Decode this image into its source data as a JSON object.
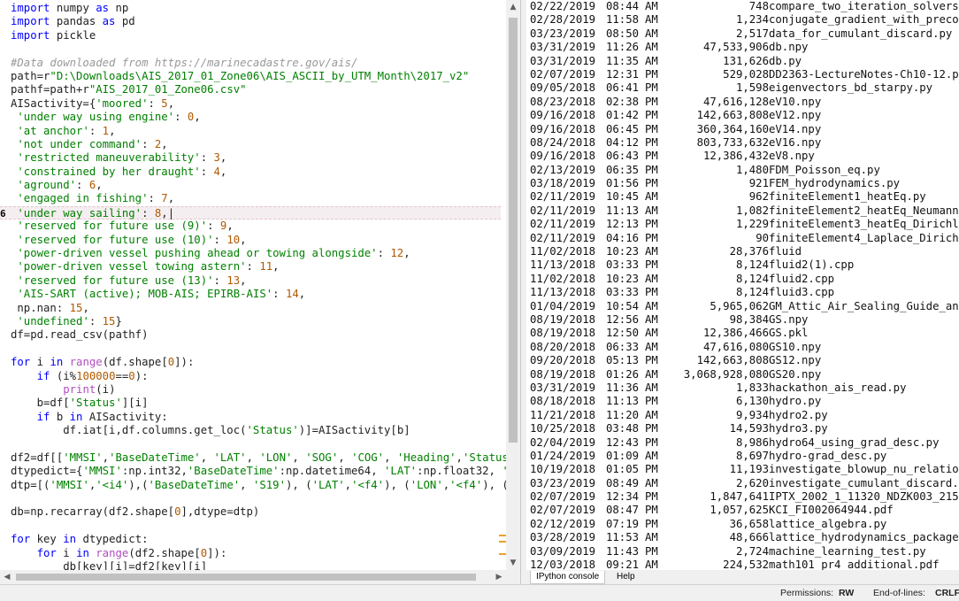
{
  "editor": {
    "lines": [
      [
        [
          "kw",
          "import"
        ],
        [
          "t",
          " numpy "
        ],
        [
          "kw",
          "as"
        ],
        [
          "t",
          " np"
        ]
      ],
      [
        [
          "kw",
          "import"
        ],
        [
          "t",
          " pandas "
        ],
        [
          "kw",
          "as"
        ],
        [
          "t",
          " pd"
        ]
      ],
      [
        [
          "kw",
          "import"
        ],
        [
          "t",
          " pickle"
        ]
      ],
      [],
      [
        [
          "com",
          "#Data downloaded from https://marinecadastre.gov/ais/"
        ]
      ],
      [
        [
          "t",
          "path=r"
        ],
        [
          "str",
          "\"D:\\Downloads\\AIS_2017_01_Zone06\\AIS_ASCII_by_UTM_Month\\2017_v2\""
        ]
      ],
      [
        [
          "t",
          "pathf=path+r"
        ],
        [
          "str",
          "\"AIS_2017_01_Zone06.csv\""
        ]
      ],
      [
        [
          "t",
          "AISactivity={"
        ],
        [
          "str",
          "'moored'"
        ],
        [
          "t",
          ": "
        ],
        [
          "num",
          "5"
        ],
        [
          "t",
          ","
        ]
      ],
      [
        [
          "t",
          " "
        ],
        [
          "str",
          "'under way using engine'"
        ],
        [
          "t",
          ": "
        ],
        [
          "num",
          "0"
        ],
        [
          "t",
          ","
        ]
      ],
      [
        [
          "t",
          " "
        ],
        [
          "str",
          "'at anchor'"
        ],
        [
          "t",
          ": "
        ],
        [
          "num",
          "1"
        ],
        [
          "t",
          ","
        ]
      ],
      [
        [
          "t",
          " "
        ],
        [
          "str",
          "'not under command'"
        ],
        [
          "t",
          ": "
        ],
        [
          "num",
          "2"
        ],
        [
          "t",
          ","
        ]
      ],
      [
        [
          "t",
          " "
        ],
        [
          "str",
          "'restricted maneuverability'"
        ],
        [
          "t",
          ": "
        ],
        [
          "num",
          "3"
        ],
        [
          "t",
          ","
        ]
      ],
      [
        [
          "t",
          " "
        ],
        [
          "str",
          "'constrained by her draught'"
        ],
        [
          "t",
          ": "
        ],
        [
          "num",
          "4"
        ],
        [
          "t",
          ","
        ]
      ],
      [
        [
          "t",
          " "
        ],
        [
          "str",
          "'aground'"
        ],
        [
          "t",
          ": "
        ],
        [
          "num",
          "6"
        ],
        [
          "t",
          ","
        ]
      ],
      [
        [
          "t",
          " "
        ],
        [
          "str",
          "'engaged in fishing'"
        ],
        [
          "t",
          ": "
        ],
        [
          "num",
          "7"
        ],
        [
          "t",
          ","
        ]
      ],
      [
        [
          "t",
          " "
        ],
        [
          "str",
          "'under way sailing'"
        ],
        [
          "t",
          ": "
        ],
        [
          "num",
          "8"
        ],
        [
          "t",
          ",|"
        ]
      ],
      [
        [
          "t",
          " "
        ],
        [
          "str",
          "'reserved for future use (9)'"
        ],
        [
          "t",
          ": "
        ],
        [
          "num",
          "9"
        ],
        [
          "t",
          ","
        ]
      ],
      [
        [
          "t",
          " "
        ],
        [
          "str",
          "'reserved for future use (10)'"
        ],
        [
          "t",
          ": "
        ],
        [
          "num",
          "10"
        ],
        [
          "t",
          ","
        ]
      ],
      [
        [
          "t",
          " "
        ],
        [
          "str",
          "'power-driven vessel pushing ahead or towing alongside'"
        ],
        [
          "t",
          ": "
        ],
        [
          "num",
          "12"
        ],
        [
          "t",
          ","
        ]
      ],
      [
        [
          "t",
          " "
        ],
        [
          "str",
          "'power-driven vessel towing astern'"
        ],
        [
          "t",
          ": "
        ],
        [
          "num",
          "11"
        ],
        [
          "t",
          ","
        ]
      ],
      [
        [
          "t",
          " "
        ],
        [
          "str",
          "'reserved for future use (13)'"
        ],
        [
          "t",
          ": "
        ],
        [
          "num",
          "13"
        ],
        [
          "t",
          ","
        ]
      ],
      [
        [
          "t",
          " "
        ],
        [
          "str",
          "'AIS-SART (active); MOB-AIS; EPIRB-AIS'"
        ],
        [
          "t",
          ": "
        ],
        [
          "num",
          "14"
        ],
        [
          "t",
          ","
        ]
      ],
      [
        [
          "t",
          " np.nan: "
        ],
        [
          "num",
          "15"
        ],
        [
          "t",
          ","
        ]
      ],
      [
        [
          "t",
          " "
        ],
        [
          "str",
          "'undefined'"
        ],
        [
          "t",
          ": "
        ],
        [
          "num",
          "15"
        ],
        [
          "t",
          "}"
        ]
      ],
      [
        [
          "t",
          "df=pd.read_csv(pathf)"
        ]
      ],
      [],
      [
        [
          "kw",
          "for"
        ],
        [
          "t",
          " i "
        ],
        [
          "kw",
          "in"
        ],
        [
          "t",
          " "
        ],
        [
          "fn",
          "range"
        ],
        [
          "t",
          "(df.shape["
        ],
        [
          "num",
          "0"
        ],
        [
          "t",
          "]):"
        ]
      ],
      [
        [
          "t",
          "    "
        ],
        [
          "kw",
          "if"
        ],
        [
          "t",
          " (i%"
        ],
        [
          "num",
          "100000"
        ],
        [
          "t",
          "=="
        ],
        [
          "num",
          "0"
        ],
        [
          "t",
          "):"
        ]
      ],
      [
        [
          "t",
          "        "
        ],
        [
          "fn",
          "print"
        ],
        [
          "t",
          "(i)"
        ]
      ],
      [
        [
          "t",
          "    b=df["
        ],
        [
          "str",
          "'Status'"
        ],
        [
          "t",
          "][i]"
        ]
      ],
      [
        [
          "t",
          "    "
        ],
        [
          "kw",
          "if"
        ],
        [
          "t",
          " b "
        ],
        [
          "kw",
          "in"
        ],
        [
          "t",
          " AISactivity:"
        ]
      ],
      [
        [
          "t",
          "        df.iat[i,df.columns.get_loc("
        ],
        [
          "str",
          "'Status'"
        ],
        [
          "t",
          ")]=AISactivity[b]"
        ]
      ],
      [],
      [
        [
          "t",
          "df2=df[["
        ],
        [
          "str",
          "'MMSI'"
        ],
        [
          "t",
          ","
        ],
        [
          "str",
          "'BaseDateTime'"
        ],
        [
          "t",
          ", "
        ],
        [
          "str",
          "'LAT'"
        ],
        [
          "t",
          ", "
        ],
        [
          "str",
          "'LON'"
        ],
        [
          "t",
          ", "
        ],
        [
          "str",
          "'SOG'"
        ],
        [
          "t",
          ", "
        ],
        [
          "str",
          "'COG'"
        ],
        [
          "t",
          ", "
        ],
        [
          "str",
          "'Heading'"
        ],
        [
          "t",
          ","
        ],
        [
          "str",
          "'Status'"
        ],
        [
          "t",
          ","
        ],
        [
          "str",
          "'D"
        ]
      ],
      [
        [
          "t",
          "dtypedict={"
        ],
        [
          "str",
          "'MMSI'"
        ],
        [
          "t",
          ":np.int32,"
        ],
        [
          "str",
          "'BaseDateTime'"
        ],
        [
          "t",
          ":np.datetime64, "
        ],
        [
          "str",
          "'LAT'"
        ],
        [
          "t",
          ":np.float32, "
        ],
        [
          "str",
          "'LON'"
        ]
      ],
      [
        [
          "t",
          "dtp=[("
        ],
        [
          "str",
          "'MMSI'"
        ],
        [
          "t",
          ","
        ],
        [
          "str",
          "'<i4'"
        ],
        [
          "t",
          "),("
        ],
        [
          "str",
          "'BaseDateTime'"
        ],
        [
          "t",
          ", "
        ],
        [
          "str",
          "'S19'"
        ],
        [
          "t",
          "), ("
        ],
        [
          "str",
          "'LAT'"
        ],
        [
          "t",
          ","
        ],
        [
          "str",
          "'<f4'"
        ],
        [
          "t",
          "), ("
        ],
        [
          "str",
          "'LON'"
        ],
        [
          "t",
          ","
        ],
        [
          "str",
          "'<f4'"
        ],
        [
          "t",
          "), ("
        ],
        [
          "str",
          "'SOG'"
        ]
      ],
      [],
      [
        [
          "t",
          "db=np.recarray(df2.shape["
        ],
        [
          "num",
          "0"
        ],
        [
          "t",
          "],dtype=dtp)"
        ]
      ],
      [],
      [
        [
          "kw",
          "for"
        ],
        [
          "t",
          " key "
        ],
        [
          "kw",
          "in"
        ],
        [
          "t",
          " dtypedict:"
        ]
      ],
      [
        [
          "t",
          "    "
        ],
        [
          "kw",
          "for"
        ],
        [
          "t",
          " i "
        ],
        [
          "kw",
          "in"
        ],
        [
          "t",
          " "
        ],
        [
          "fn",
          "range"
        ],
        [
          "t",
          "(df2.shape["
        ],
        [
          "num",
          "0"
        ],
        [
          "t",
          "]):"
        ]
      ],
      [
        [
          "t",
          "        db[key][i]=df2[key][i]"
        ]
      ]
    ],
    "gutter_line_number": "6",
    "highlighted_line_index": 15
  },
  "files": [
    [
      "02/22/2019",
      "08:44",
      "AM",
      "748",
      "compare_two_iteration_solvers.p"
    ],
    [
      "02/28/2019",
      "11:58",
      "AM",
      "1,234",
      "conjugate_gradient_with_precond"
    ],
    [
      "03/23/2019",
      "08:50",
      "AM",
      "2,517",
      "data_for_cumulant_discard.py"
    ],
    [
      "03/31/2019",
      "11:26",
      "AM",
      "47,533,906",
      "db.npy"
    ],
    [
      "03/31/2019",
      "11:35",
      "AM",
      "131,626",
      "db.py"
    ],
    [
      "02/07/2019",
      "12:31",
      "PM",
      "529,028",
      "DD2363-LectureNotes-Ch10-12.pdf"
    ],
    [
      "09/05/2018",
      "06:41",
      "PM",
      "1,598",
      "eigenvectors_bd_starpy.py"
    ],
    [
      "08/23/2018",
      "02:38",
      "PM",
      "47,616,128",
      "eV10.npy"
    ],
    [
      "09/16/2018",
      "01:42",
      "PM",
      "142,663,808",
      "eV12.npy"
    ],
    [
      "09/16/2018",
      "06:45",
      "PM",
      "360,364,160",
      "eV14.npy"
    ],
    [
      "08/24/2018",
      "04:12",
      "PM",
      "803,733,632",
      "eV16.npy"
    ],
    [
      "09/16/2018",
      "06:43",
      "PM",
      "12,386,432",
      "eV8.npy"
    ],
    [
      "02/13/2019",
      "06:35",
      "PM",
      "1,480",
      "FDM_Poisson_eq.py"
    ],
    [
      "03/18/2019",
      "01:56",
      "PM",
      "921",
      "FEM_hydrodynamics.py"
    ],
    [
      "02/11/2019",
      "10:45",
      "AM",
      "962",
      "finiteElement1_heatEq.py"
    ],
    [
      "02/11/2019",
      "11:13",
      "AM",
      "1,082",
      "finiteElement2_heatEq_Neumann_b"
    ],
    [
      "02/11/2019",
      "12:13",
      "PM",
      "1,229",
      "finiteElement3_heatEq_Dirichlet"
    ],
    [
      "02/11/2019",
      "04:16",
      "PM",
      "90",
      "finiteElement4_Laplace_Dirichle"
    ],
    [
      "11/02/2018",
      "10:23",
      "AM",
      "28,376",
      "fluid"
    ],
    [
      "11/13/2018",
      "03:33",
      "PM",
      "8,124",
      "fluid2(1).cpp"
    ],
    [
      "11/02/2018",
      "10:23",
      "AM",
      "8,124",
      "fluid2.cpp"
    ],
    [
      "11/13/2018",
      "03:33",
      "PM",
      "8,124",
      "fluid3.cpp"
    ],
    [
      "01/04/2019",
      "10:54",
      "AM",
      "5,965,062",
      "GM_Attic_Air_Sealing_Guide_and_"
    ],
    [
      "08/19/2018",
      "12:56",
      "AM",
      "98,384",
      "GS.npy"
    ],
    [
      "08/19/2018",
      "12:50",
      "AM",
      "12,386,466",
      "GS.pkl"
    ],
    [
      "08/20/2018",
      "06:33",
      "AM",
      "47,616,080",
      "GS10.npy"
    ],
    [
      "09/20/2018",
      "05:13",
      "PM",
      "142,663,808",
      "GS12.npy"
    ],
    [
      "08/19/2018",
      "01:26",
      "AM",
      "3,068,928,080",
      "GS20.npy"
    ],
    [
      "03/31/2019",
      "11:36",
      "AM",
      "1,833",
      "hackathon_ais_read.py"
    ],
    [
      "08/18/2018",
      "11:13",
      "PM",
      "6,130",
      "hydro.py"
    ],
    [
      "11/21/2018",
      "11:20",
      "AM",
      "9,934",
      "hydro2.py"
    ],
    [
      "10/25/2018",
      "03:48",
      "PM",
      "14,593",
      "hydro3.py"
    ],
    [
      "02/04/2019",
      "12:43",
      "PM",
      "8,986",
      "hydro64_using_grad_desc.py"
    ],
    [
      "01/24/2019",
      "01:09",
      "AM",
      "8,697",
      "hydro-grad_desc.py"
    ],
    [
      "10/19/2018",
      "01:05",
      "PM",
      "11,193",
      "investigate_blowup_nu_relation."
    ],
    [
      "03/23/2019",
      "08:49",
      "AM",
      "2,620",
      "investigate_cumulant_discard.py"
    ],
    [
      "02/07/2019",
      "12:34",
      "PM",
      "1,847,641",
      "IPTX_2002_1_11320_NDZK003_21549"
    ],
    [
      "02/07/2019",
      "08:47",
      "PM",
      "1,057,625",
      "KCI_FI002064944.pdf"
    ],
    [
      "02/12/2019",
      "07:19",
      "PM",
      "36,658",
      "lattice_algebra.py"
    ],
    [
      "03/28/2019",
      "11:53",
      "AM",
      "48,666",
      "lattice_hydrodynamics_package.p"
    ],
    [
      "03/09/2019",
      "11:43",
      "PM",
      "2,724",
      "machine_learning_test.py"
    ],
    [
      "12/03/2018",
      "09:21",
      "AM",
      "224,532",
      "math101_pr4_additional.pdf"
    ]
  ],
  "tabs": {
    "ipython": "IPython console",
    "help": "Help"
  },
  "status": {
    "permissions_label": "Permissions:",
    "permissions_value": "RW",
    "eol_label": "End-of-lines:",
    "eol_value": "CRLF"
  },
  "icons": {
    "scroll_up": "triangle-up",
    "scroll_down": "triangle-down",
    "scroll_left": "triangle-left",
    "scroll_right": "triangle-right"
  }
}
